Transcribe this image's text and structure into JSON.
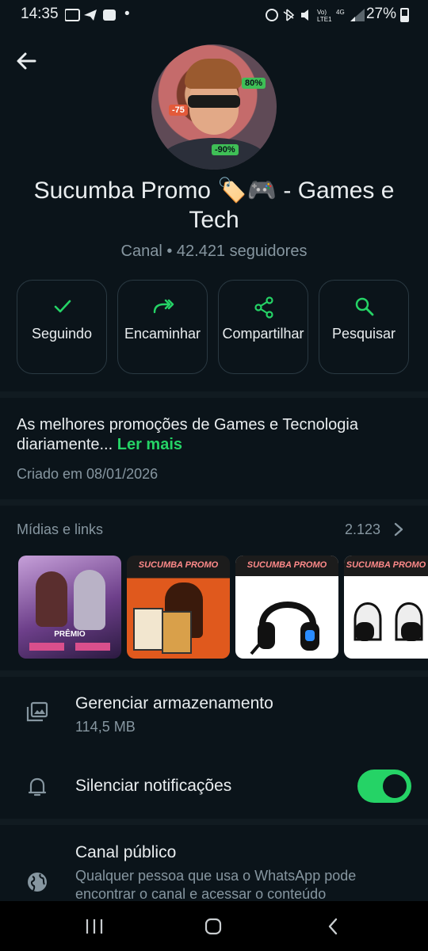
{
  "status_bar": {
    "time": "14:35",
    "dot": "•",
    "battery": "27%"
  },
  "channel": {
    "name": "Sucumba Promo 🏷️🎮  - Games e Tech",
    "meta": "Canal • 42.421 seguidores",
    "avatar_tags": [
      "80%",
      "-75",
      "-90%"
    ]
  },
  "actions": [
    {
      "label": "Seguindo",
      "icon": "check-icon"
    },
    {
      "label": "Encaminhar",
      "icon": "forward-icon"
    },
    {
      "label": "Compartilhar",
      "icon": "share-icon"
    },
    {
      "label": "Pesquisar",
      "icon": "search-icon"
    }
  ],
  "description": {
    "text": "As melhores promoções de Games e Tecnologia diariamente... ",
    "more": "Ler mais",
    "created": "Criado em 08/01/2026"
  },
  "media": {
    "title": "Mídias e links",
    "count": "2.123",
    "thumbs": [
      {
        "caption": "PRÊMIO"
      },
      {
        "caption": "SUCUMBA PROMO"
      },
      {
        "caption": "SUCUMBA PROMO"
      },
      {
        "caption": "SUCUMBA PROMO"
      }
    ]
  },
  "settings": {
    "storage_title": "Gerenciar armazenamento",
    "storage_size": "114,5 MB",
    "mute_title": "Silenciar notificações",
    "mute_on": true,
    "public_title": "Canal público",
    "public_sub": "Qualquer pessoa que usa o WhatsApp pode encontrar o canal e acessar o conteúdo"
  },
  "colors": {
    "background": "#0b141a",
    "accent": "#25d366",
    "secondary_text": "#8696a0"
  }
}
